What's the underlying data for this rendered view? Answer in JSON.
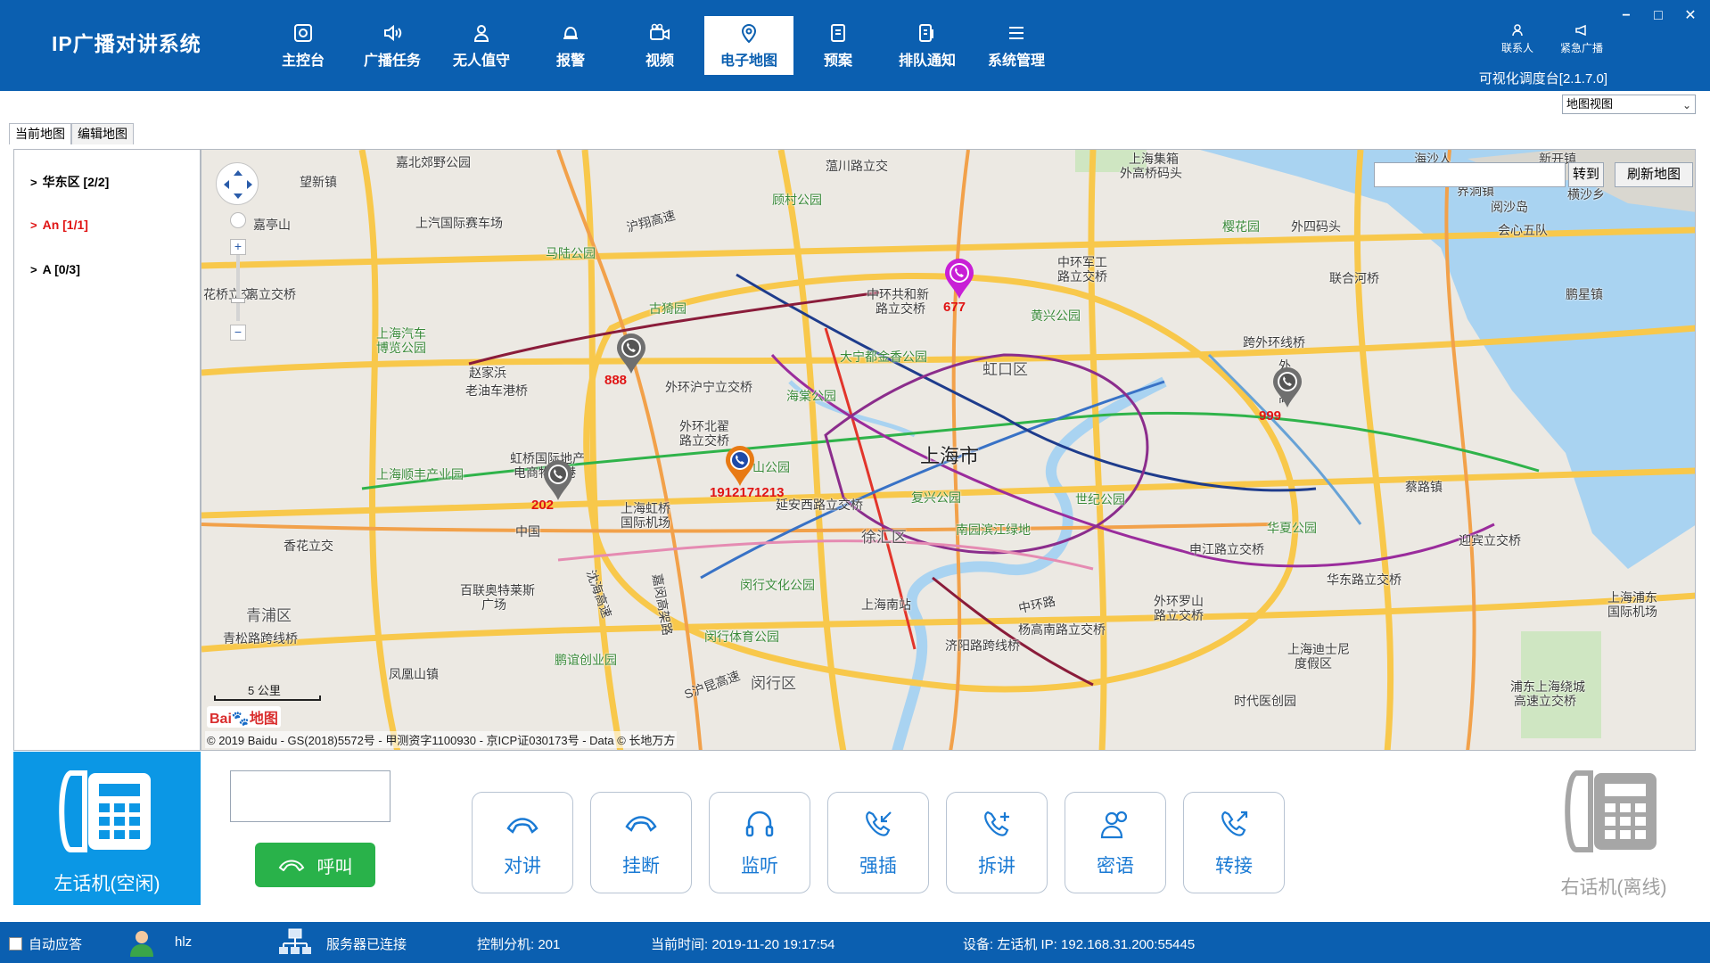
{
  "app": {
    "title": "IP广播对讲系统",
    "version": "可视化调度台[2.1.7.0]"
  },
  "nav": [
    {
      "label": "主控台",
      "icon": "console-icon"
    },
    {
      "label": "广播任务",
      "icon": "speaker-icon"
    },
    {
      "label": "无人值守",
      "icon": "person-icon"
    },
    {
      "label": "报警",
      "icon": "alarm-icon"
    },
    {
      "label": "视频",
      "icon": "video-icon"
    },
    {
      "label": "电子地图",
      "icon": "map-pin-icon",
      "active": true
    },
    {
      "label": "预案",
      "icon": "plan-icon"
    },
    {
      "label": "排队通知",
      "icon": "queue-icon"
    },
    {
      "label": "系统管理",
      "icon": "settings-list-icon"
    }
  ],
  "top_right": {
    "contacts": "联系人",
    "emergency": "紧急广播"
  },
  "window_controls": {
    "minimize": "−",
    "maximize": "□",
    "close": "✕"
  },
  "map_view_select": {
    "value": "地图视图"
  },
  "map_tabs": [
    "当前地图",
    "编辑地图"
  ],
  "tree": [
    {
      "label": "华东区 [2/2]",
      "chevron": ">",
      "red": false
    },
    {
      "label": "An [1/1]",
      "chevron": ">",
      "red": true
    },
    {
      "label": "A [0/3]",
      "chevron": ">",
      "red": false
    }
  ],
  "map": {
    "goto_label": "转到",
    "refresh_label": "刷新地图",
    "search_value": "",
    "scale": "5 公里",
    "logo_a": "Bai",
    "logo_b": "地图",
    "copyright": "© 2019 Baidu - GS(2018)5572号 - 甲测资字1100930 - 京ICP证030173号 - Data © 长地万方",
    "labels": {
      "l1": "嘉北郊野公园",
      "l2": "蕰川路立交",
      "l3": "上海集箱",
      "l4": "外高桥码头",
      "l5": "望新镇",
      "l6": "上汽国际赛车场",
      "l7": "顾村公园",
      "l8": "嘉亭山",
      "l9": "马陆公园",
      "l10": "沪翔高速",
      "l11": "樱花园",
      "l12": "外四码头",
      "l13": "中环军工",
      "l14": "路立交桥",
      "l15": "花桥立交",
      "l16": "离立交桥",
      "l17": "中环共和新",
      "l18": "路立交桥",
      "l19": "古猗园",
      "l20": "黄兴公园",
      "l21": "联合河桥",
      "l22": "上海汽车",
      "l23": "博览公园",
      "l24": "大宁都金香公园",
      "l25": "跨外环线桥",
      "l26": "虹口区",
      "l27": "赵家浜",
      "l28": "外环沪宁立交桥",
      "l29": "老油车港桥",
      "l30": "海棠公园",
      "l31": "外",
      "l32": "环",
      "l33": "高",
      "l34": "上海市",
      "l35": "外环北翟",
      "l36": "路立交桥",
      "l37": "中山公园",
      "l38": "虹桥国际地产",
      "l39": "电商物流港",
      "l40": "上海顺丰产业园",
      "l41": "复兴公园",
      "l42": "世纪公园",
      "l43": "蔡路镇",
      "l44": "延安西路立交桥",
      "l45": "上海虹桥",
      "l46": "国际机场",
      "l47": "华夏公园",
      "l48": "南园滨江绿地",
      "l49": "徐汇区",
      "l50": "中国",
      "l51": "香花立交",
      "l52": "申江路立交桥",
      "l53": "迎宾立交桥",
      "l54": "百联奥特莱斯",
      "l55": "广场",
      "l56": "闵行文化公园",
      "l57": "华东路立交桥",
      "l58": "青浦区",
      "l59": "上海南站",
      "l60": "中环路",
      "l61": "外环罗山",
      "l62": "路立交桥",
      "l63": "上海浦东",
      "l64": "国际机场",
      "l65": "青松路跨线桥",
      "l66": "闵行体育公园",
      "l67": "杨高南路立交桥",
      "l68": "济阳路跨线桥",
      "l69": "上海迪士尼",
      "l70": "度假区",
      "l71": "凤凰山镇",
      "l72": "鹏谊创业园",
      "l73": "闵行区",
      "l74": "时代医创园",
      "l75": "浦东上海绕城",
      "l76": "高速立交桥",
      "l77": "沈海高速",
      "l78": "嘉闵高架路",
      "l79": "S沪昆高速",
      "l80": "鹏星镇",
      "l81": "界洞镇",
      "l82": "横沙乡",
      "l83": "新开镇",
      "l84": "阅沙岛",
      "l85": "海沙人",
      "l86": "会心五队"
    },
    "devices": [
      {
        "number": "677",
        "color": "#c81fd6"
      },
      {
        "number": "888",
        "color": "#7a7a7a"
      },
      {
        "number": "999",
        "color": "#7a7a7a"
      },
      {
        "number": "1912171213",
        "color": "#e87a14"
      },
      {
        "number": "202",
        "color": "#7a7a7a"
      }
    ]
  },
  "left_phone": {
    "label": "左话机(空闲)"
  },
  "call": {
    "number_value": "",
    "button_label": "呼叫"
  },
  "actions": [
    {
      "label": "对讲",
      "icon": "handset-icon"
    },
    {
      "label": "挂断",
      "icon": "hangup-icon"
    },
    {
      "label": "监听",
      "icon": "headset-icon"
    },
    {
      "label": "强插",
      "icon": "barge-in-icon"
    },
    {
      "label": "拆讲",
      "icon": "split-call-icon"
    },
    {
      "label": "密语",
      "icon": "whisper-icon"
    },
    {
      "label": "转接",
      "icon": "transfer-icon"
    }
  ],
  "right_phone": {
    "label": "右话机(离线)"
  },
  "status": {
    "auto_answer": "自动应答",
    "user": "hlz",
    "server": "服务器已连接",
    "extension": "控制分机: 201",
    "time": "当前时间: 2019-11-20 19:17:54",
    "device": "设备: 左话机  IP: 192.168.31.200:55445"
  },
  "colors": {
    "topbar": "#0b5fb0",
    "accent_blue": "#0b97e5",
    "call_green": "#29b24a",
    "pin_red_text": "#e01414"
  }
}
